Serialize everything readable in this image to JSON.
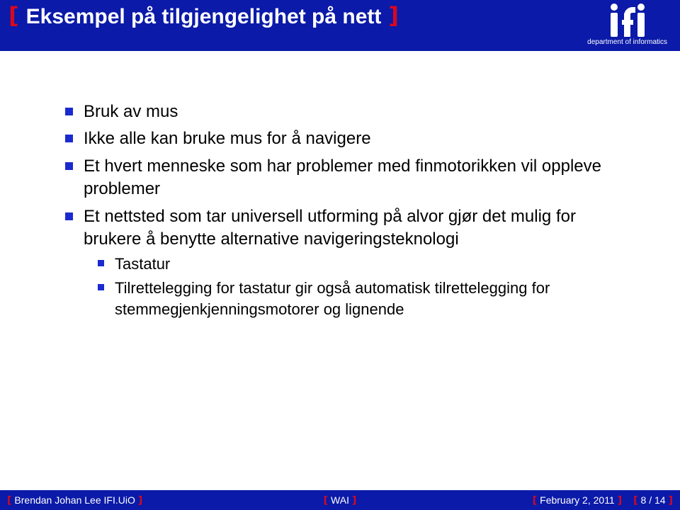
{
  "header": {
    "title": "Eksempel på tilgjengelighet på nett",
    "logo_text": "department of informatics"
  },
  "bullets": {
    "b0": "Bruk av mus",
    "b1": "Ikke alle kan bruke mus for å navigere",
    "b2": "Et hvert menneske som har problemer med finmotorikken vil oppleve problemer",
    "b3": "Et nettsted som tar universell utforming på alvor gjør det mulig for brukere å benytte alternative navigeringsteknologi",
    "b3_sub0": "Tastatur",
    "b3_sub1": "Tilrettelegging for tastatur gir også automatisk tilrettelegging for stemmegjenkjenningsmotorer og lignende"
  },
  "footer": {
    "author": "Brendan Johan Lee  IFI.UiO",
    "center": "WAI",
    "date": "February 2, 2011",
    "page": "8 / 14"
  }
}
